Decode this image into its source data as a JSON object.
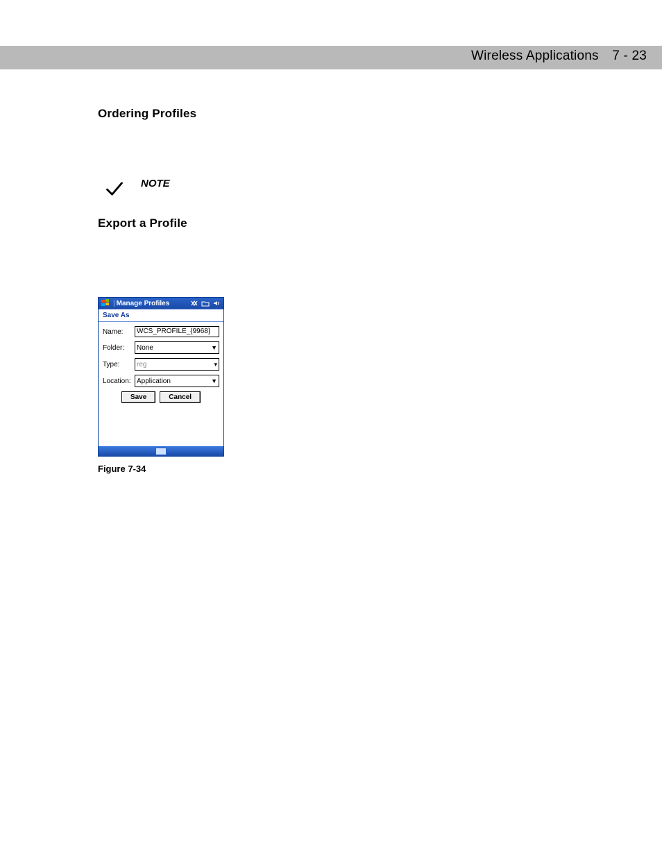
{
  "header": {
    "chapter": "Wireless Applications",
    "page": "7 - 23"
  },
  "sections": {
    "ordering": "Ordering Profiles",
    "export": "Export a Profile"
  },
  "note": {
    "label": "NOTE"
  },
  "dialog": {
    "title": "Manage Profiles",
    "menu": "Save As",
    "fields": {
      "name": {
        "label": "Name:",
        "value": "WCS_PROFILE_{9968}"
      },
      "folder": {
        "label": "Folder:",
        "value": "None"
      },
      "type": {
        "label": "Type:",
        "value": "reg"
      },
      "location": {
        "label": "Location:",
        "value": "Application"
      }
    },
    "buttons": {
      "save": "Save",
      "cancel": "Cancel"
    }
  },
  "figure": {
    "caption": "Figure 7-34"
  }
}
